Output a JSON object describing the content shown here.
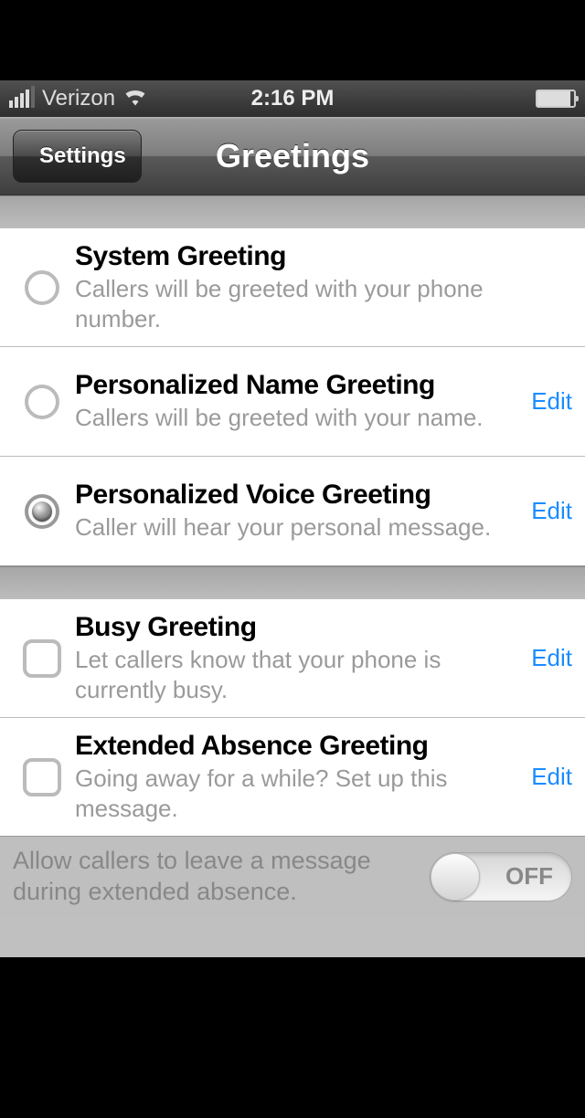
{
  "statusBar": {
    "carrier": "Verizon",
    "time": "2:16 PM"
  },
  "nav": {
    "back": "Settings",
    "title": "Greetings"
  },
  "group1": [
    {
      "title": "System Greeting",
      "desc": "Callers will be greeted with your phone number.",
      "selected": false,
      "edit": null
    },
    {
      "title": "Personalized Name Greeting",
      "desc": "Callers will be greeted with your name.",
      "selected": false,
      "edit": "Edit"
    },
    {
      "title": "Personalized Voice Greeting",
      "desc": "Caller will hear your personal message.",
      "selected": true,
      "edit": "Edit"
    }
  ],
  "group2": [
    {
      "title": "Busy Greeting",
      "desc": "Let callers know that your phone is currently busy.",
      "checked": false,
      "edit": "Edit"
    },
    {
      "title": "Extended Absence Greeting",
      "desc": "Going away for a while? Set up this message.",
      "checked": false,
      "edit": "Edit"
    }
  ],
  "footer": {
    "text": "Allow callers to leave a message during extended absence.",
    "toggle": "OFF"
  }
}
